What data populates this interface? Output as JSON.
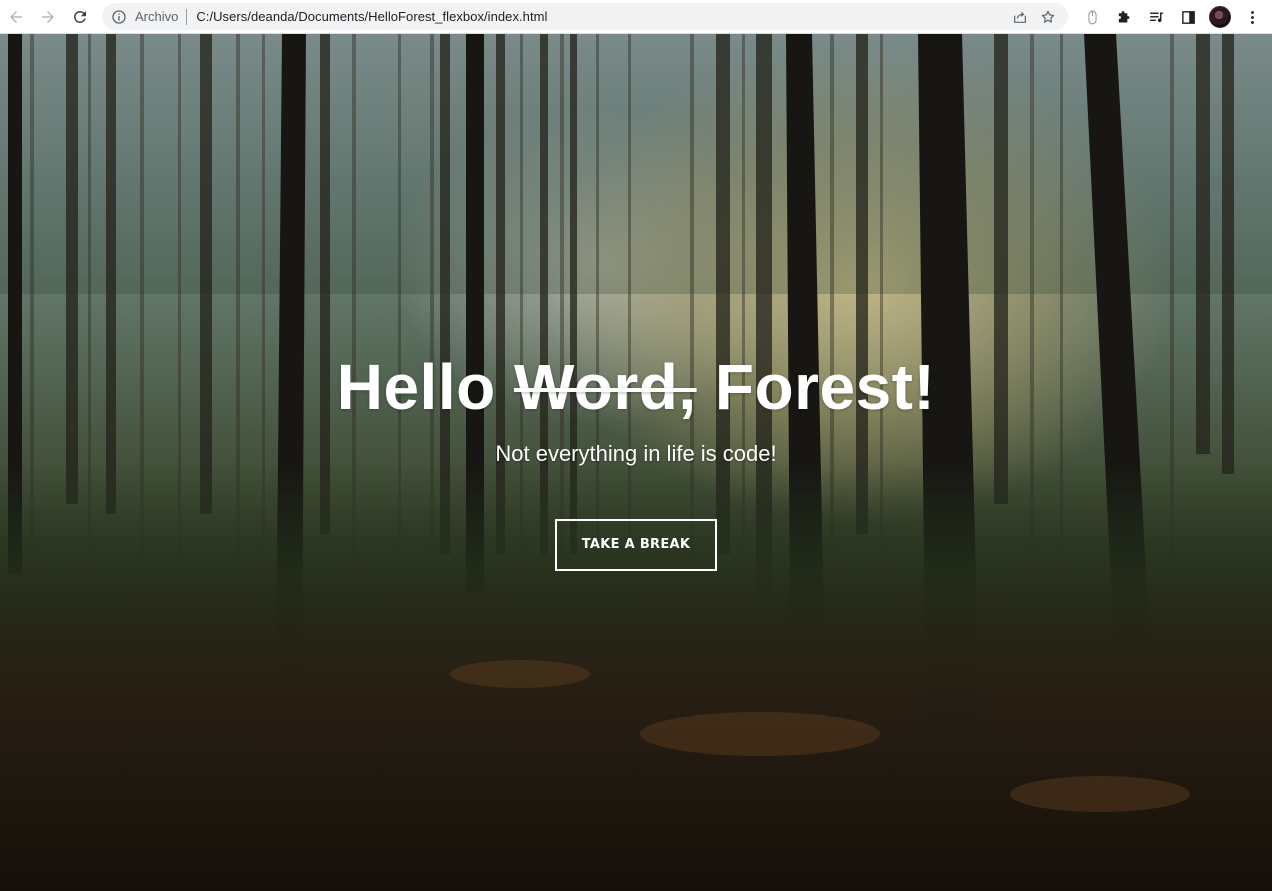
{
  "browser": {
    "scheme_label": "Archivo",
    "url": "C:/Users/deanda/Documents/HelloForest_flexbox/index.html",
    "nav_icons": [
      "back-arrow-icon",
      "forward-arrow-icon",
      "reload-icon"
    ],
    "omnibox_icons": [
      "site-info-icon",
      "share-icon",
      "bookmark-star-icon"
    ],
    "extension_icons": [
      "mouse-extension-icon",
      "extensions-puzzle-icon",
      "media-queue-icon",
      "side-panel-icon",
      "profile-avatar",
      "more-menu-icon"
    ]
  },
  "hero": {
    "title_start": "Hello ",
    "title_struck": "Word,",
    "title_end": " Forest!",
    "subtitle": "Not everything in life is code!",
    "button_label": "TAKE A BREAK"
  },
  "colors": {
    "text": "#ffffff",
    "button_border": "#ffffff",
    "toolbar_bg": "#ffffff",
    "omnibox_bg": "#f1f3f4"
  }
}
